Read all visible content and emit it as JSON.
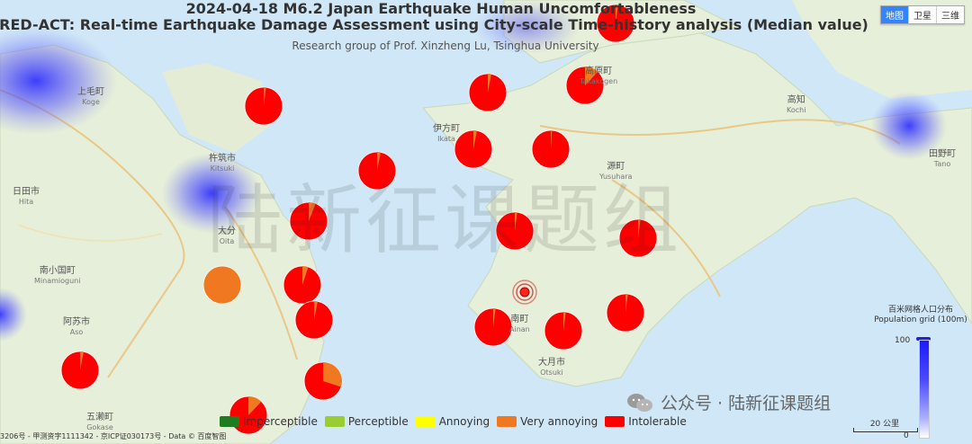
{
  "title_line1": "2024-04-18 M6.2 Japan Earthquake Human Uncomfortableness",
  "title_line2": "RED-ACT: Real-time Earthquake Damage Assessment using City-scale Time-history analysis (Median value)",
  "subtitle": "Research group of Prof. Xinzheng Lu, Tsinghua University",
  "watermark": "陆新征课题组",
  "map_type_buttons": [
    "地图",
    "卫星",
    "三维"
  ],
  "place_labels": [
    {
      "name": "上毛町",
      "sub": "Koge"
    },
    {
      "name": "杵筑市",
      "sub": "Kitsuki"
    },
    {
      "name": "日田市",
      "sub": "Hita"
    },
    {
      "name": "大分",
      "sub": "Oita"
    },
    {
      "name": "南小国町",
      "sub": "Minamioguni"
    },
    {
      "name": "阿苏市",
      "sub": "Aso"
    },
    {
      "name": "五濑町",
      "sub": "Gokase"
    },
    {
      "name": "伊方町",
      "sub": "Ikata"
    },
    {
      "name": "高原町",
      "sub": "Takakogen"
    },
    {
      "name": "高知",
      "sub": "Kochi"
    },
    {
      "name": "田野町",
      "sub": "Tano"
    },
    {
      "name": "源町",
      "sub": "Yusuhara"
    },
    {
      "name": "南町",
      "sub": "Ainan"
    },
    {
      "name": "大月市",
      "sub": "Otsuki"
    }
  ],
  "legend": [
    {
      "label": "Imperceptible",
      "color": "#1e7d1e"
    },
    {
      "label": "Perceptible",
      "color": "#9acd32"
    },
    {
      "label": "Annoying",
      "color": "#ffff00"
    },
    {
      "label": "Very annoying",
      "color": "#f07820"
    },
    {
      "label": "Intolerable",
      "color": "#ff0000"
    }
  ],
  "population_legend": {
    "title_cn": "百米网格人口分布",
    "title_en": "Population grid (100m)",
    "max": "100",
    "min": "0"
  },
  "scale_label": "20 公里",
  "copyright": "3206号 - 甲测资字1111342 - 京ICP证030173号 - Data © 百度智图",
  "wechat_text": "公众号 · 陆新征课题组"
}
